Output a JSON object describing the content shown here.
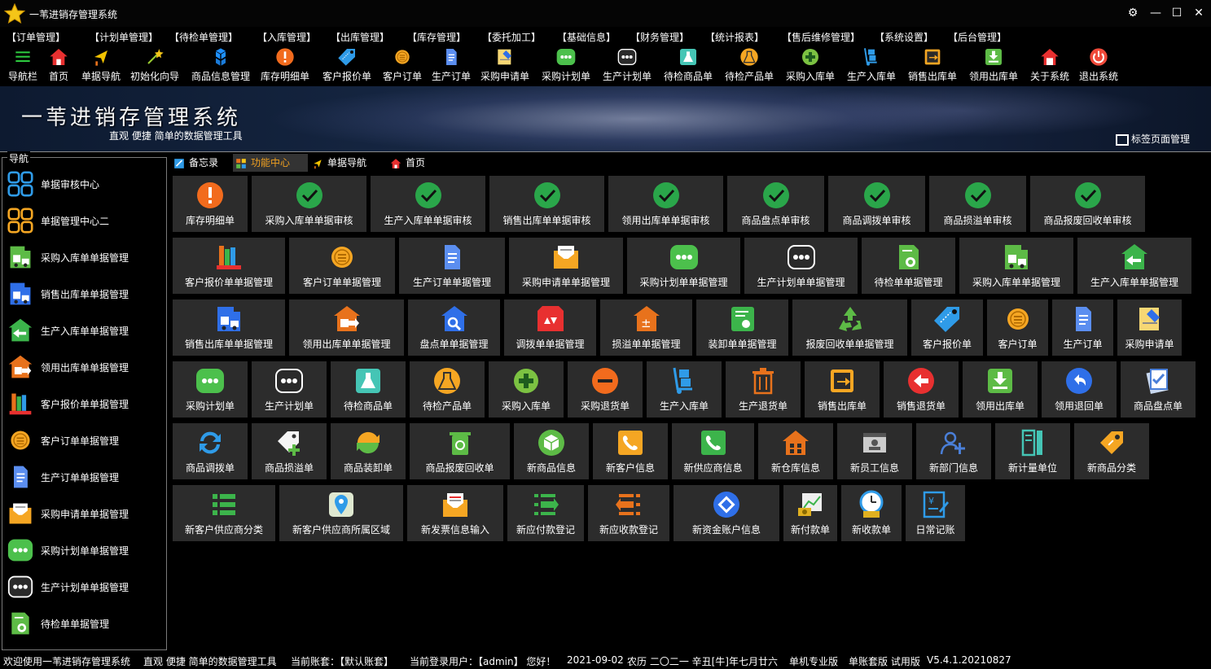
{
  "window": {
    "title": "一苇进销存管理系统"
  },
  "menu": [
    "【订单管理】",
    "【计划单管理】",
    "【待检单管理】",
    "【入库管理】",
    "【出库管理】",
    "【库存管理】",
    "【委托加工】",
    "【基础信息】",
    "【财务管理】",
    "【统计报表】",
    "【售后维修管理】",
    "【系统设置】",
    "【后台管理】"
  ],
  "toolbar": [
    {
      "label": "导航栏",
      "icon": "menu-lines-icon",
      "color": "#2ecc40"
    },
    {
      "label": "首页",
      "icon": "home-icon",
      "color": "#e83030"
    },
    {
      "label": "单据导航",
      "icon": "navigation-icon",
      "color": "#f2c200"
    },
    {
      "label": "初始化向导",
      "icon": "magic-wand-icon",
      "color": "#9acd32"
    },
    {
      "label": "商品信息管理",
      "icon": "cubes-icon",
      "color": "#1e90ff"
    },
    {
      "label": "库存明细单",
      "icon": "warning-icon",
      "color": "#f26b1d"
    },
    {
      "label": "客户报价单",
      "icon": "price-tag-icon",
      "color": "#2f9be8"
    },
    {
      "label": "客户订单",
      "icon": "order-coin-icon",
      "color": "#f5a623"
    },
    {
      "label": "生产订单",
      "icon": "document-icon",
      "color": "#5b8ef0"
    },
    {
      "label": "采购申请单",
      "icon": "request-form-icon",
      "color": "#f7d774"
    },
    {
      "label": "采购计划单",
      "icon": "chat-dots-icon",
      "color": "#4cc04c"
    },
    {
      "label": "生产计划单",
      "icon": "chat-dots-icon",
      "color": "#ffffff"
    },
    {
      "label": "待检商品单",
      "icon": "flask-icon",
      "color": "#45c5b5"
    },
    {
      "label": "待检产品单",
      "icon": "beaker-icon",
      "color": "#f5a623"
    },
    {
      "label": "采购入库单",
      "icon": "plus-circle-icon",
      "color": "#7cc242"
    },
    {
      "label": "生产入库单",
      "icon": "hand-truck-icon",
      "color": "#2f9be8"
    },
    {
      "label": "销售出库单",
      "icon": "export-box-icon",
      "color": "#f5a623"
    },
    {
      "label": "领用出库单",
      "icon": "download-box-icon",
      "color": "#5dbb46"
    },
    {
      "label": "关于系统",
      "icon": "house-info-icon",
      "color": "#e83030"
    },
    {
      "label": "退出系统",
      "icon": "power-icon",
      "color": "#f04a3a"
    }
  ],
  "banner": {
    "title": "一苇进销存管理系统",
    "subtitle": "直观 便捷 简单的数据管理工具"
  },
  "tab_manager": {
    "label": "标签页面管理"
  },
  "nav": {
    "title": "导航",
    "items": [
      {
        "label": "单据审核中心",
        "icon": "grid-apps-icon",
        "color": "#2f9be8"
      },
      {
        "label": "单据管理中心二",
        "icon": "grid-apps-icon",
        "color": "#f5a623"
      },
      {
        "label": "采购入库单单据管理",
        "icon": "warehouse-truck-icon",
        "color": "#5dbb46"
      },
      {
        "label": "销售出库单单据管理",
        "icon": "warehouse-truck-icon",
        "color": "#2f6fe8"
      },
      {
        "label": "生产入库单单据管理",
        "icon": "warehouse-in-icon",
        "color": "#3cb44b"
      },
      {
        "label": "领用出库单单据管理",
        "icon": "warehouse-out-icon",
        "color": "#e8721c"
      },
      {
        "label": "客户报价单单据管理",
        "icon": "books-icon",
        "color": "#e85a3a"
      },
      {
        "label": "客户订单单据管理",
        "icon": "order-coin-icon",
        "color": "#f5a623"
      },
      {
        "label": "生产订单单据管理",
        "icon": "document-icon",
        "color": "#5b8ef0"
      },
      {
        "label": "采购申请单单据管理",
        "icon": "envelope-icon",
        "color": "#f5a623"
      },
      {
        "label": "采购计划单单据管理",
        "icon": "chat-dots-icon",
        "color": "#4cc04c"
      },
      {
        "label": "生产计划单单据管理",
        "icon": "chat-dots-icon",
        "color": "#ffffff"
      },
      {
        "label": "待检单单据管理",
        "icon": "inspection-doc-icon",
        "color": "#5dbb46"
      }
    ]
  },
  "tabs": [
    {
      "label": "备忘录",
      "icon": "memo-icon",
      "color": "#2f9be8",
      "active": false
    },
    {
      "label": "功能中心",
      "icon": "function-center-icon",
      "color": "#5dbb46",
      "active": true
    },
    {
      "label": "单据导航",
      "icon": "navigation-icon",
      "color": "#f2c200",
      "active": false
    },
    {
      "label": "首页",
      "icon": "home-icon",
      "color": "#e83030",
      "active": false
    }
  ],
  "tiles": [
    [
      {
        "label": "库存明细单",
        "icon": "warning-icon",
        "color": "#f26b1d"
      },
      {
        "label": "采购入库单单据审核",
        "icon": "check-circle-icon",
        "color": "#2aa64a"
      },
      {
        "label": "生产入库单单据审核",
        "icon": "check-circle-icon",
        "color": "#2aa64a"
      },
      {
        "label": "销售出库单单据审核",
        "icon": "check-circle-icon",
        "color": "#2aa64a"
      },
      {
        "label": "领用出库单单据审核",
        "icon": "check-circle-icon",
        "color": "#2aa64a"
      },
      {
        "label": "商品盘点单审核",
        "icon": "check-circle-icon",
        "color": "#2aa64a"
      },
      {
        "label": "商品调拨单审核",
        "icon": "check-circle-icon",
        "color": "#2aa64a"
      },
      {
        "label": "商品损溢单审核",
        "icon": "check-circle-icon",
        "color": "#2aa64a"
      },
      {
        "label": "商品报废回收单审核",
        "icon": "check-circle-icon",
        "color": "#2aa64a"
      }
    ],
    [
      {
        "label": "客户报价单单据管理",
        "icon": "books-icon",
        "color": "#e85a3a"
      },
      {
        "label": "客户订单单据管理",
        "icon": "order-coin-icon",
        "color": "#f5a623"
      },
      {
        "label": "生产订单单据管理",
        "icon": "document-icon",
        "color": "#5b8ef0"
      },
      {
        "label": "采购申请单单据管理",
        "icon": "envelope-icon",
        "color": "#f5a623"
      },
      {
        "label": "采购计划单单据管理",
        "icon": "chat-dots-icon",
        "color": "#4cc04c"
      },
      {
        "label": "生产计划单单据管理",
        "icon": "chat-dots-icon",
        "color": "#ffffff"
      },
      {
        "label": "待检单单据管理",
        "icon": "inspection-doc-icon",
        "color": "#5dbb46"
      },
      {
        "label": "采购入库单单据管理",
        "icon": "warehouse-truck-icon",
        "color": "#5dbb46"
      },
      {
        "label": "生产入库单单据管理",
        "icon": "warehouse-in-icon",
        "color": "#3cb44b"
      }
    ],
    [
      {
        "label": "销售出库单单据管理",
        "icon": "warehouse-truck-icon",
        "color": "#2f6fe8"
      },
      {
        "label": "领用出库单单据管理",
        "icon": "warehouse-out-icon",
        "color": "#e8721c"
      },
      {
        "label": "盘点单单据管理",
        "icon": "warehouse-search-icon",
        "color": "#2f6fe8"
      },
      {
        "label": "调拨单单据管理",
        "icon": "transfer-box-icon",
        "color": "#e83030"
      },
      {
        "label": "损溢单单据管理",
        "icon": "plusminus-house-icon",
        "color": "#e8721c"
      },
      {
        "label": "装卸单单据管理",
        "icon": "loading-doc-icon",
        "color": "#3cb44b"
      },
      {
        "label": "报废回收单单据管理",
        "icon": "recycle-icon",
        "color": "#5dbb46"
      },
      {
        "label": "客户报价单",
        "icon": "price-tag-icon",
        "color": "#2f9be8"
      },
      {
        "label": "客户订单",
        "icon": "order-coin-icon",
        "color": "#f5a623"
      },
      {
        "label": "生产订单",
        "icon": "document-icon",
        "color": "#5b8ef0"
      },
      {
        "label": "采购申请单",
        "icon": "request-form-icon",
        "color": "#f7d774"
      }
    ],
    [
      {
        "label": "采购计划单",
        "icon": "chat-dots-icon",
        "color": "#4cc04c"
      },
      {
        "label": "生产计划单",
        "icon": "chat-dots-icon",
        "color": "#ffffff"
      },
      {
        "label": "待检商品单",
        "icon": "flask-icon",
        "color": "#45c5b5"
      },
      {
        "label": "待检产品单",
        "icon": "beaker-icon",
        "color": "#f5a623"
      },
      {
        "label": "采购入库单",
        "icon": "plus-circle-icon",
        "color": "#7cc242"
      },
      {
        "label": "采购退货单",
        "icon": "minus-circle-icon",
        "color": "#f26b1d"
      },
      {
        "label": "生产入库单",
        "icon": "hand-truck-icon",
        "color": "#2f9be8"
      },
      {
        "label": "生产退货单",
        "icon": "trash-icon",
        "color": "#e8721c"
      },
      {
        "label": "销售出库单",
        "icon": "export-box-icon",
        "color": "#f5a623"
      },
      {
        "label": "销售退货单",
        "icon": "arrow-left-circle-icon",
        "color": "#e83030"
      },
      {
        "label": "领用出库单",
        "icon": "download-box-icon",
        "color": "#5dbb46"
      },
      {
        "label": "领用退回单",
        "icon": "undo-circle-icon",
        "color": "#2f6fe8"
      },
      {
        "label": "商品盘点单",
        "icon": "inventory-check-icon",
        "color": "#4a7fd8"
      }
    ],
    [
      {
        "label": "商品调拨单",
        "icon": "refresh-icon",
        "color": "#2f9be8"
      },
      {
        "label": "商品损溢单",
        "icon": "tag-plus-icon",
        "color": "#f5f5f5"
      },
      {
        "label": "商品装卸单",
        "icon": "swap-circle-icon",
        "color": "#5dbb46"
      },
      {
        "label": "商品报废回收单",
        "icon": "recycle-bin-icon",
        "color": "#5dbb46"
      },
      {
        "label": "新商品信息",
        "icon": "new-product-icon",
        "color": "#5dbb46"
      },
      {
        "label": "新客户信息",
        "icon": "phone-card-icon",
        "color": "#f5a623"
      },
      {
        "label": "新供应商信息",
        "icon": "phone-card-icon",
        "color": "#3cb44b"
      },
      {
        "label": "新仓库信息",
        "icon": "warehouse-icon",
        "color": "#e8721c"
      },
      {
        "label": "新员工信息",
        "icon": "employee-card-icon",
        "color": "#cccccc"
      },
      {
        "label": "新部门信息",
        "icon": "users-add-icon",
        "color": "#4a7fd8"
      },
      {
        "label": "新计量单位",
        "icon": "ruler-doc-icon",
        "color": "#45c5b5"
      },
      {
        "label": "新商品分类",
        "icon": "category-tag-icon",
        "color": "#f5a623"
      }
    ],
    [
      {
        "label": "新客户供应商分类",
        "icon": "list-category-icon",
        "color": "#3cb44b"
      },
      {
        "label": "新客户供应商所属区域",
        "icon": "map-pin-icon",
        "color": "#2f9be8"
      },
      {
        "label": "新发票信息输入",
        "icon": "invoice-envelope-icon",
        "color": "#f5a623"
      },
      {
        "label": "新应付款登记",
        "icon": "payable-list-icon",
        "color": "#3cb44b"
      },
      {
        "label": "新应收款登记",
        "icon": "receivable-list-icon",
        "color": "#e8721c"
      },
      {
        "label": "新资金账户信息",
        "icon": "diamond-circle-icon",
        "color": "#2f6fe8"
      },
      {
        "label": "新付款单",
        "icon": "payment-chart-icon",
        "color": "#e0b020"
      },
      {
        "label": "新收款单",
        "icon": "clock-money-icon",
        "color": "#2f9be8"
      },
      {
        "label": "日常记账",
        "icon": "ledger-icon",
        "color": "#2f9be8"
      }
    ]
  ],
  "status": [
    "欢迎使用一苇进销存管理系统",
    "直观 便捷 简单的数据管理工具",
    "当前账套：【默认账套】",
    "当前登录用户：【admin】 您好！",
    "2021-09-02",
    "农历 二〇二一 辛丑[牛]年七月廿六",
    "单机专业版",
    "单账套版 试用版",
    "V5.4.1.20210827"
  ]
}
